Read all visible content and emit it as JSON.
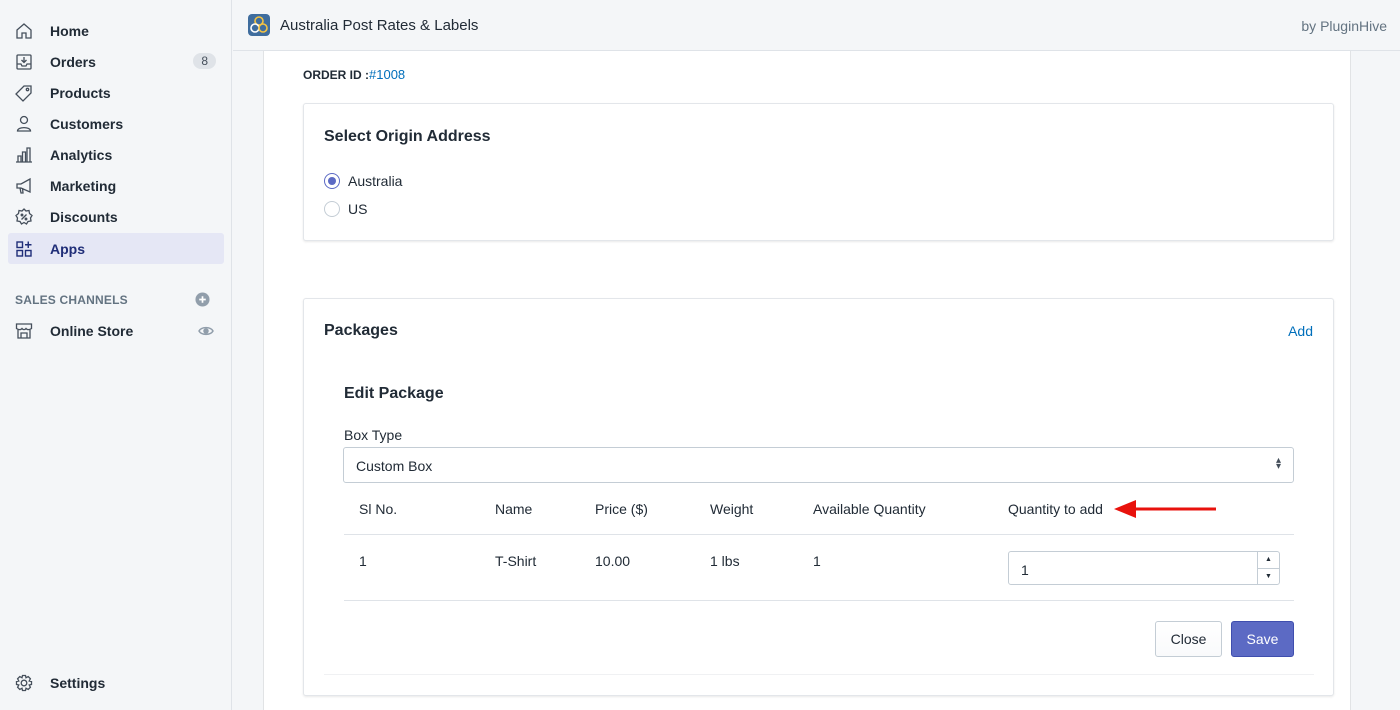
{
  "sidebar": {
    "items": [
      {
        "label": "Home",
        "icon": "home-icon"
      },
      {
        "label": "Orders",
        "icon": "orders-icon",
        "badge": "8"
      },
      {
        "label": "Products",
        "icon": "tag-icon"
      },
      {
        "label": "Customers",
        "icon": "person-icon"
      },
      {
        "label": "Analytics",
        "icon": "bar-chart-icon"
      },
      {
        "label": "Marketing",
        "icon": "megaphone-icon"
      },
      {
        "label": "Discounts",
        "icon": "discount-icon"
      },
      {
        "label": "Apps",
        "icon": "apps-icon",
        "active": true
      }
    ],
    "sales_channels_title": "SALES CHANNELS",
    "online_store": "Online Store",
    "settings": "Settings"
  },
  "topbar": {
    "app_title": "Australia Post Rates & Labels",
    "by": "by PluginHive"
  },
  "order": {
    "label": "ORDER ID :",
    "id": "#1008"
  },
  "origin": {
    "title": "Select Origin Address",
    "options": [
      {
        "label": "Australia",
        "checked": true
      },
      {
        "label": "US",
        "checked": false
      }
    ]
  },
  "packages": {
    "title": "Packages",
    "add_label": "Add",
    "edit_title": "Edit Package",
    "box_type_label": "Box Type",
    "box_type_value": "Custom Box",
    "columns": [
      "Sl No.",
      "Name",
      "Price ($)",
      "Weight",
      "Available Quantity",
      "Quantity to add"
    ],
    "rows": [
      {
        "sl": "1",
        "name": "T-Shirt",
        "price": "10.00",
        "weight": "1 lbs",
        "available": "1",
        "qty": "1"
      }
    ],
    "close_label": "Close",
    "save_label": "Save"
  },
  "colors": {
    "accent": "#5c6ac4",
    "link": "#006fbb",
    "annotation_arrow": "#e8120c"
  }
}
